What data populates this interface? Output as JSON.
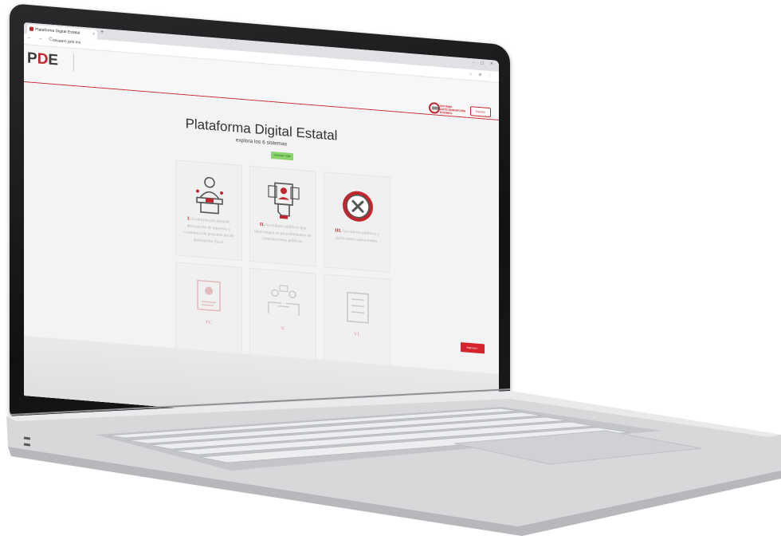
{
  "browser": {
    "tab_title": "Plataforma Digital Estatal",
    "tab_close": "×",
    "new_tab": "+",
    "window_controls": "– ▢ ✕",
    "nav_buttons": "← → C",
    "url": "sesaem.gob.mx",
    "address_icons": "☆ ⊕ ⋮"
  },
  "header": {
    "logo_letters": [
      "P",
      "D",
      "E"
    ],
    "partner_logo_text": "SISTEMA ANTICORRUPCIÓN EDOMEX",
    "login_label": "Ingresar"
  },
  "main": {
    "title": "Plataforma Digital Estatal",
    "subtitle": "explora los 6 sistemas",
    "conocer_label": "Conocer más",
    "login_button": "Ingresar ›"
  },
  "systems": [
    {
      "num": "I.",
      "label": "Evolución patrimonial, declaración de intereses y constancia de presentación de declaración fiscal.",
      "icon": "speaker-podium-icon"
    },
    {
      "num": "II.",
      "label": "Servidores públicos que intervengan en procedimientos de contrataciones públicas.",
      "icon": "id-card-hand-icon"
    },
    {
      "num": "III.",
      "label": "Servidores públicos y particulares sancionados.",
      "icon": "x-circle-icon"
    },
    {
      "num": "IV.",
      "label": "",
      "icon": "profile-document-icon"
    },
    {
      "num": "V.",
      "label": "",
      "icon": "meeting-people-icon"
    },
    {
      "num": "VI.",
      "label": "",
      "icon": "checklist-document-icon"
    }
  ],
  "colors": {
    "brand_red": "#c0262d",
    "accent_green": "#8bd36b",
    "button_red": "#d5232c"
  }
}
